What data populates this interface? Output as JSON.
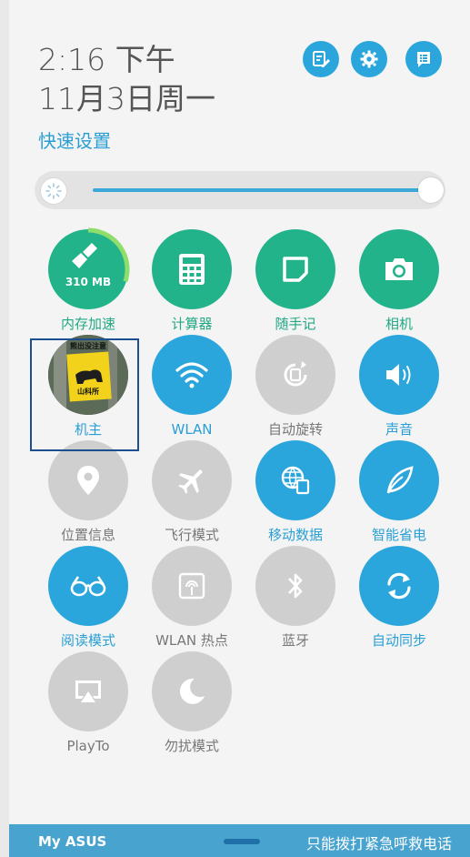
{
  "header": {
    "time": "2:16 下午",
    "date": "11月3日周一",
    "quick_settings_label": "快速设置",
    "buttons": [
      {
        "name": "edit-icon"
      },
      {
        "name": "gear-icon"
      },
      {
        "name": "list-icon"
      }
    ]
  },
  "brightness": {
    "level_fraction": 0.98
  },
  "tiles": [
    {
      "label": "内存加速",
      "state": "green",
      "icon": "broom-icon",
      "badge": "310 MB",
      "memory_fraction": 0.3
    },
    {
      "label": "计算器",
      "state": "green",
      "icon": "calculator-icon"
    },
    {
      "label": "随手记",
      "state": "green",
      "icon": "note-icon"
    },
    {
      "label": "相机",
      "state": "green",
      "icon": "camera-icon"
    },
    {
      "label": "机主",
      "state": "photo",
      "icon": "owner-photo",
      "photo_text_top": "熊出没注意",
      "photo_text_bottom": "山科所"
    },
    {
      "label": "WLAN",
      "state": "blue",
      "icon": "wifi-icon"
    },
    {
      "label": "自动旋转",
      "state": "gray",
      "icon": "rotate-icon"
    },
    {
      "label": "声音",
      "state": "blue",
      "icon": "sound-icon"
    },
    {
      "label": "位置信息",
      "state": "gray",
      "icon": "location-icon"
    },
    {
      "label": "飞行模式",
      "state": "gray",
      "icon": "airplane-icon"
    },
    {
      "label": "移动数据",
      "state": "blue",
      "icon": "mobile-data-icon"
    },
    {
      "label": "智能省电",
      "state": "blue",
      "icon": "leaf-icon"
    },
    {
      "label": "阅读模式",
      "state": "blue",
      "icon": "glasses-icon"
    },
    {
      "label": "WLAN 热点",
      "state": "gray",
      "icon": "hotspot-icon"
    },
    {
      "label": "蓝牙",
      "state": "gray",
      "icon": "bluetooth-icon"
    },
    {
      "label": "自动同步",
      "state": "blue",
      "icon": "sync-icon"
    },
    {
      "label": "PlayTo",
      "state": "gray",
      "icon": "playto-icon"
    },
    {
      "label": "勿扰模式",
      "state": "gray",
      "icon": "moon-icon"
    }
  ],
  "footer": {
    "brand": "My ASUS",
    "emergency": "只能拨打紧急呼救电话"
  },
  "colors": {
    "green": "#23b38a",
    "blue": "#2aa6dc",
    "gray": "#cfcfcf"
  }
}
